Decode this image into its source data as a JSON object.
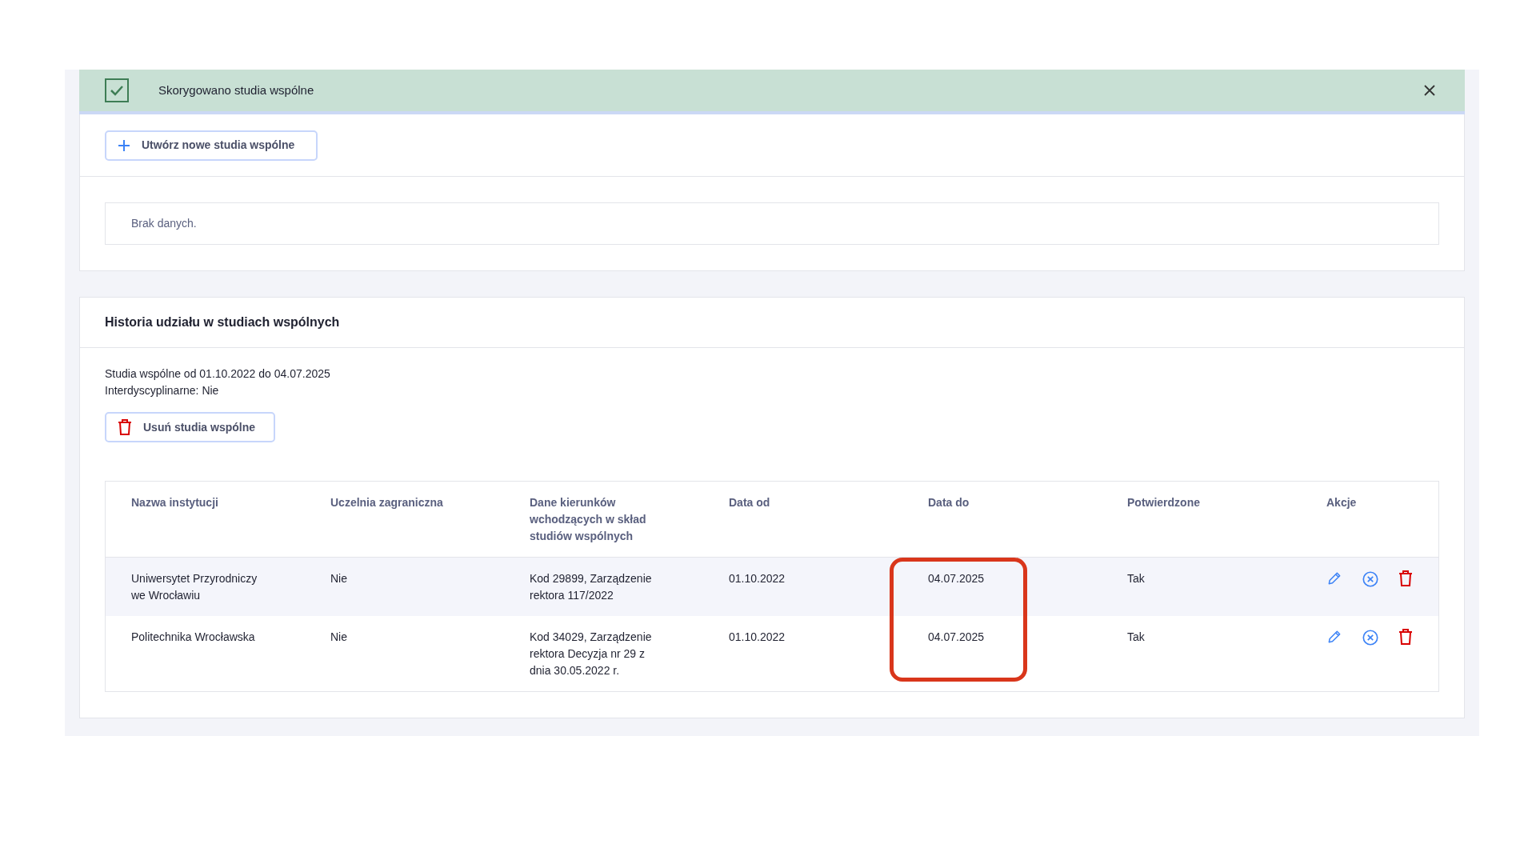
{
  "alert": {
    "message": "Skorygowano studia wspólne",
    "checked": true
  },
  "create_button": {
    "label": "Utwórz nowe studia wspólne"
  },
  "empty_state": "Brak danych.",
  "history": {
    "title": "Historia udziału w studiach wspólnych",
    "summary": [
      "Studia wspólne od 01.10.2022 do 04.07.2025",
      "Interdyscyplinarne: Nie"
    ],
    "delete_button": {
      "label": "Usuń studia wspólne"
    },
    "table": {
      "columns": [
        {
          "label": "Nazwa instytucji",
          "highlighted": false
        },
        {
          "label": "Uczelnia zagraniczna",
          "highlighted": false
        },
        {
          "label": "Dane kierunków wchodzących w skład studiów wspólnych",
          "highlighted": false
        },
        {
          "label": "Data od",
          "highlighted": false
        },
        {
          "label": "Data do",
          "highlighted": true
        },
        {
          "label": "Potwierdzone",
          "highlighted": false
        },
        {
          "label": "Akcje",
          "highlighted": false
        }
      ],
      "rows": [
        {
          "cells": [
            "Uniwersytet Przyrodniczy we Wrocławiu",
            "Nie",
            "Kod 29899, Zarządzenie rektora 117/2022",
            "01.10.2022",
            "04.07.2025",
            "Tak"
          ]
        },
        {
          "cells": [
            "Politechnika Wrocławska",
            "Nie",
            "Kod 34029, Zarządzenie rektora Decyzja nr 29 z dnia 30.05.2022 r.",
            "01.10.2022",
            "04.07.2025",
            "Tak"
          ]
        }
      ]
    }
  }
}
